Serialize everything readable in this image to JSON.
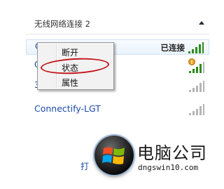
{
  "section": {
    "title": "无线网络连接 2"
  },
  "networks": [
    {
      "name": "C",
      "status": "已连接",
      "secured": false
    },
    {
      "name": "C",
      "status": "",
      "secured": true
    },
    {
      "name": "3",
      "status": "",
      "secured": false
    },
    {
      "name": "Connectify-LGT",
      "status": "",
      "secured": false
    }
  ],
  "context_menu": {
    "items": [
      "断开",
      "状态",
      "属性"
    ],
    "highlighted": "状态"
  },
  "bottom": {
    "link_text": "打"
  },
  "logo": {
    "title": "电脑公司",
    "url": "dngswin10.com"
  },
  "colors": {
    "link": "#1c4aa6",
    "signal_active": "#2e8b1f",
    "signal_inactive": "#b5b5b5",
    "annotation": "#c4141a"
  }
}
